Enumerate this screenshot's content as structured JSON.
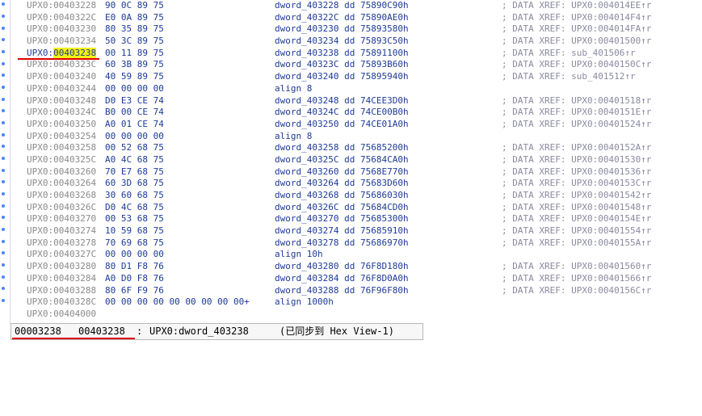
{
  "status_bar": {
    "offset": "00003238",
    "address": "00403238",
    "separator": ":",
    "symbol": "UPX0:dword_403238",
    "sync": "(已同步到 Hex View-1)"
  },
  "rows": [
    {
      "addr": "UPX0:00403228",
      "bytes": "90 0C 89 75",
      "sym": "dword_403228 dd 75890C90h",
      "comment": "; DATA XREF: UPX0:004014EE↑r"
    },
    {
      "addr": "UPX0:0040322C",
      "bytes": "E0 0A 89 75",
      "sym": "dword_40322C dd 75890AE0h",
      "comment": "; DATA XREF: UPX0:004014F4↑r"
    },
    {
      "addr": "UPX0:00403230",
      "bytes": "80 35 89 75",
      "sym": "dword_403230 dd 75893580h",
      "comment": "; DATA XREF: UPX0:004014FA↑r"
    },
    {
      "addr": "UPX0:00403234",
      "bytes": "50 3C 89 75",
      "sym": "dword_403234 dd 75893C50h",
      "comment": "; DATA XREF: UPX0:00401500↑r"
    },
    {
      "addr_prefix": "UPX0:",
      "addr_hl": "00403238",
      "bytes": "00 11 89 75",
      "sym": "dword_403238 dd 75891100h",
      "comment": "; DATA XREF: sub_401506↑r"
    },
    {
      "addr": "UPX0:0040323C",
      "bytes": "60 3B 89 75",
      "sym": "dword_40323C dd 75893B60h",
      "comment": "; DATA XREF: UPX0:0040150C↑r"
    },
    {
      "addr": "UPX0:00403240",
      "bytes": "40 59 89 75",
      "sym": "dword_403240 dd 75895940h",
      "comment": "; DATA XREF: sub_401512↑r"
    },
    {
      "addr": "UPX0:00403244",
      "bytes": "00 00 00 00",
      "sym": "align 8",
      "comment": ""
    },
    {
      "addr": "UPX0:00403248",
      "bytes": "D0 E3 CE 74",
      "sym": "dword_403248 dd 74CEE3D0h",
      "comment": "; DATA XREF: UPX0:00401518↑r"
    },
    {
      "addr": "UPX0:0040324C",
      "bytes": "B0 00 CE 74",
      "sym": "dword_40324C dd 74CE00B0h",
      "comment": "; DATA XREF: UPX0:0040151E↑r"
    },
    {
      "addr": "UPX0:00403250",
      "bytes": "A0 01 CE 74",
      "sym": "dword_403250 dd 74CE01A0h",
      "comment": "; DATA XREF: UPX0:00401524↑r"
    },
    {
      "addr": "UPX0:00403254",
      "bytes": "00 00 00 00",
      "sym": "align 8",
      "comment": ""
    },
    {
      "addr": "UPX0:00403258",
      "bytes": "00 52 68 75",
      "sym": "dword_403258 dd 75685200h",
      "comment": "; DATA XREF: UPX0:0040152A↑r"
    },
    {
      "addr": "UPX0:0040325C",
      "bytes": "A0 4C 68 75",
      "sym": "dword_40325C dd 75684CA0h",
      "comment": "; DATA XREF: UPX0:00401530↑r"
    },
    {
      "addr": "UPX0:00403260",
      "bytes": "70 E7 68 75",
      "sym": "dword_403260 dd 7568E770h",
      "comment": "; DATA XREF: UPX0:00401536↑r"
    },
    {
      "addr": "UPX0:00403264",
      "bytes": "60 3D 68 75",
      "sym": "dword_403264 dd 75683D60h",
      "comment": "; DATA XREF: UPX0:0040153C↑r"
    },
    {
      "addr": "UPX0:00403268",
      "bytes": "30 60 68 75",
      "sym": "dword_403268 dd 75686030h",
      "comment": "; DATA XREF: UPX0:00401542↑r"
    },
    {
      "addr": "UPX0:0040326C",
      "bytes": "D0 4C 68 75",
      "sym": "dword_40326C dd 75684CD0h",
      "comment": "; DATA XREF: UPX0:00401548↑r"
    },
    {
      "addr": "UPX0:00403270",
      "bytes": "00 53 68 75",
      "sym": "dword_403270 dd 75685300h",
      "comment": "; DATA XREF: UPX0:0040154E↑r"
    },
    {
      "addr": "UPX0:00403274",
      "bytes": "10 59 68 75",
      "sym": "dword_403274 dd 75685910h",
      "comment": "; DATA XREF: UPX0:00401554↑r"
    },
    {
      "addr": "UPX0:00403278",
      "bytes": "70 69 68 75",
      "sym": "dword_403278 dd 75686970h",
      "comment": "; DATA XREF: UPX0:0040155A↑r"
    },
    {
      "addr": "UPX0:0040327C",
      "bytes": "00 00 00 00",
      "sym": "align 10h",
      "comment": ""
    },
    {
      "addr": "UPX0:00403280",
      "bytes": "80 D1 F8 76",
      "sym": "dword_403280 dd 76F8D180h",
      "comment": "; DATA XREF: UPX0:00401560↑r"
    },
    {
      "addr": "UPX0:00403284",
      "bytes": "A0 D0 F8 76",
      "sym": "dword_403284 dd 76F8D0A0h",
      "comment": "; DATA XREF: UPX0:00401566↑r"
    },
    {
      "addr": "UPX0:00403288",
      "bytes": "80 6F F9 76",
      "sym": "dword_403288 dd 76F96F80h",
      "comment": "; DATA XREF: UPX0:0040156C↑r"
    },
    {
      "addr": "UPX0:0040328C",
      "bytes": "00 00 00 00 00 00 00 00 00+",
      "sym": "align 1000h",
      "comment": ""
    },
    {
      "addr": "UPX0:00404000",
      "bytes": "",
      "sym": "",
      "comment": ""
    }
  ],
  "colors": {
    "highlight": "#f2f214",
    "annotation_red": "#e00000",
    "code_blue": "#1e3a9a",
    "address_gray": "#8a8a8a",
    "gutter_dot": "#4a86ff"
  },
  "icons": [
    "breakpoint-dot-icon"
  ]
}
